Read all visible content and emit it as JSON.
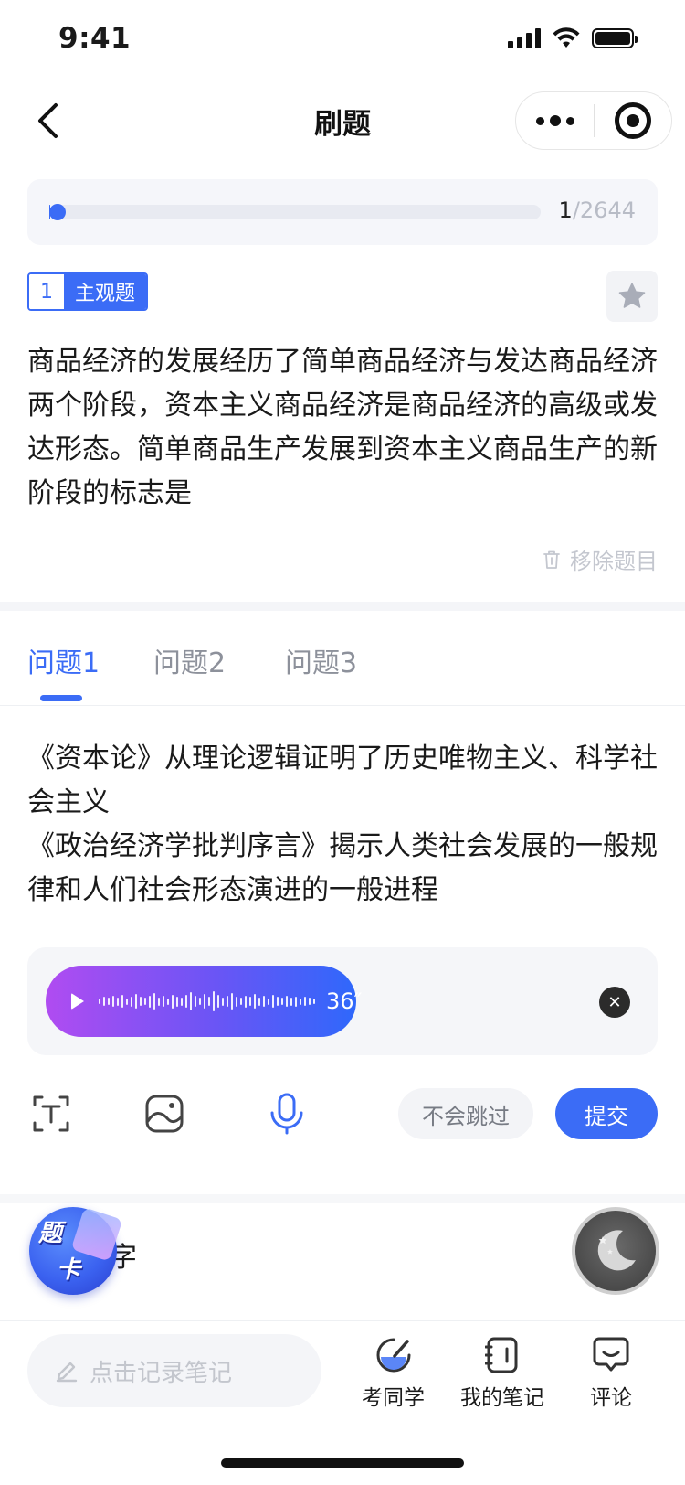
{
  "status_bar": {
    "time": "9:41"
  },
  "nav": {
    "title": "刷题"
  },
  "progress": {
    "current": "1",
    "total": "/2644",
    "fraction": 0.0004
  },
  "question": {
    "number": "1",
    "type": "主观题",
    "stem": "商品经济的发展经历了简单商品经济与发达商品经济两个阶段，资本主义商品经济是商品经济的高级或发达形态。简单商品生产发展到资本主义商品生产的新阶段的标志是",
    "remove_label": "移除题目"
  },
  "tabs": [
    {
      "label": "问题1",
      "active": true
    },
    {
      "label": "问题2",
      "active": false
    },
    {
      "label": "问题3",
      "active": false
    }
  ],
  "sub_question": {
    "line1": "《资本论》从理论逻辑证明了历史唯物主义、科学社会主义",
    "line2": "《政治经济学批判序言》揭示人类社会发展的一般规律和人们社会形态演进的一般进程"
  },
  "answer": {
    "voice_duration": "36″"
  },
  "toolbar": {
    "skip_label": "不会跳过",
    "submit_label": "提交"
  },
  "section": {
    "label_partial": "字"
  },
  "float_card": {
    "line1": "题",
    "line2": "卡"
  },
  "bottom_bar": {
    "note_placeholder": "点击记录笔记",
    "items": [
      {
        "label": "考同学",
        "icon": "pen-circle-icon"
      },
      {
        "label": "我的笔记",
        "icon": "notebook-icon"
      },
      {
        "label": "评论",
        "icon": "comment-icon"
      }
    ]
  },
  "colors": {
    "accent": "#3b6cf6",
    "voice_gradient_start": "#b04cf1",
    "voice_gradient_end": "#2f68fb"
  }
}
